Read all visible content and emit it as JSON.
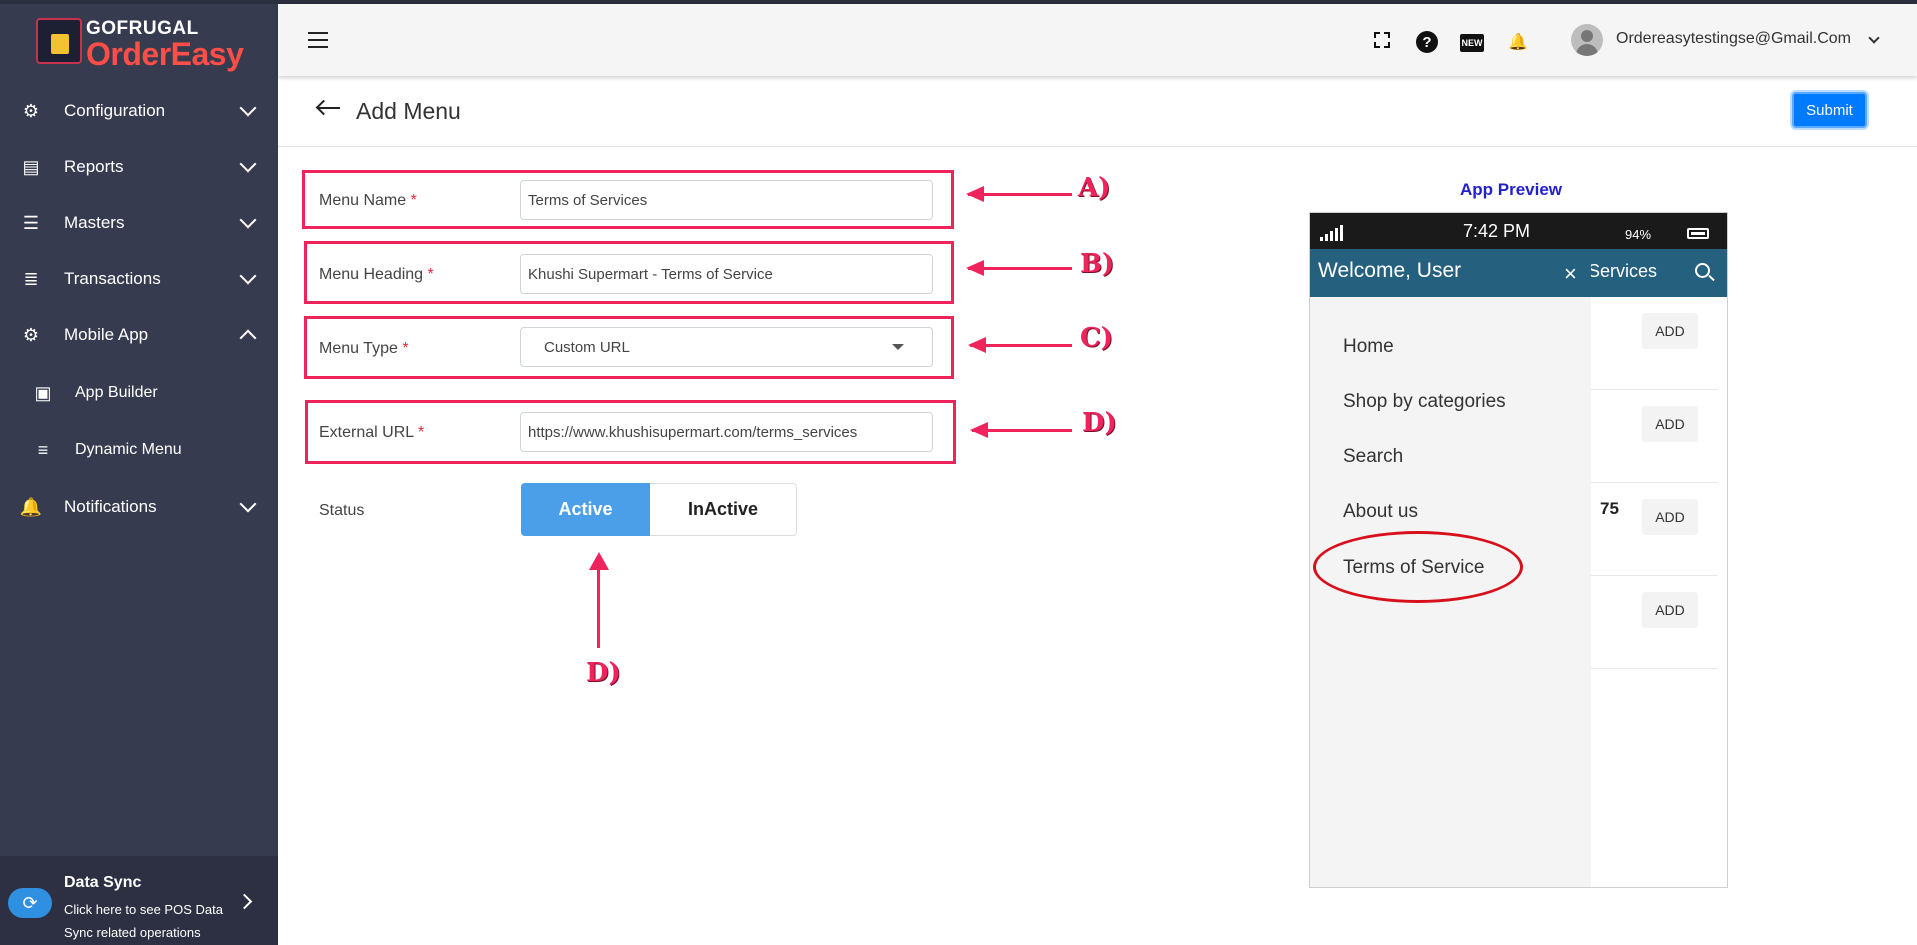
{
  "brand": {
    "small": "GOFRUGAL",
    "big": "OrderEasy"
  },
  "sidebar": {
    "items": [
      {
        "label": "Configuration",
        "icon": "gear-icon"
      },
      {
        "label": "Reports",
        "icon": "reports-icon"
      },
      {
        "label": "Masters",
        "icon": "masters-icon"
      },
      {
        "label": "Transactions",
        "icon": "list-icon"
      },
      {
        "label": "Mobile App",
        "icon": "gear-icon"
      },
      {
        "label": "App Builder",
        "icon": "app-builder-icon"
      },
      {
        "label": "Dynamic Menu",
        "icon": "menu-icon"
      },
      {
        "label": "Notifications",
        "icon": "bell-icon"
      }
    ],
    "sync": {
      "title": "Data Sync",
      "desc": "Click here to see POS Data Sync related operations"
    }
  },
  "header": {
    "user_email": "Ordereasytestingse@Gmail.Com",
    "new_badge": "NEW"
  },
  "page": {
    "title": "Add Menu",
    "submit_label": "Submit"
  },
  "form": {
    "menu_name": {
      "label": "Menu Name",
      "value": "Terms of Services"
    },
    "menu_heading": {
      "label": "Menu Heading",
      "value": "Khushi Supermart - Terms of Service"
    },
    "menu_type": {
      "label": "Menu Type",
      "value": "Custom URL"
    },
    "external_url": {
      "label": "External URL",
      "value": "https://www.khushisupermart.com/terms_services"
    },
    "required_mark": "*",
    "status": {
      "label": "Status",
      "active": "Active",
      "inactive": "InActive",
      "selected": "Active"
    }
  },
  "annotations": {
    "a": "A)",
    "b": "B)",
    "c": "C)",
    "d": "D)",
    "d2": "D)"
  },
  "preview": {
    "title": "App Preview",
    "status_time": "7:42 PM",
    "battery": "94%",
    "appbar_title": "f Services",
    "drawer": {
      "welcome": "Welcome, User",
      "close": "×",
      "items": [
        "Home",
        "Shop by categories",
        "Search",
        "About us",
        "Terms of Service"
      ]
    },
    "add_label": "ADD",
    "price_fragment": "75"
  },
  "colors": {
    "sidebar": "#363b4f",
    "accent": "#007bff",
    "annotation": "#f0245c",
    "appbar": "#25607f"
  }
}
